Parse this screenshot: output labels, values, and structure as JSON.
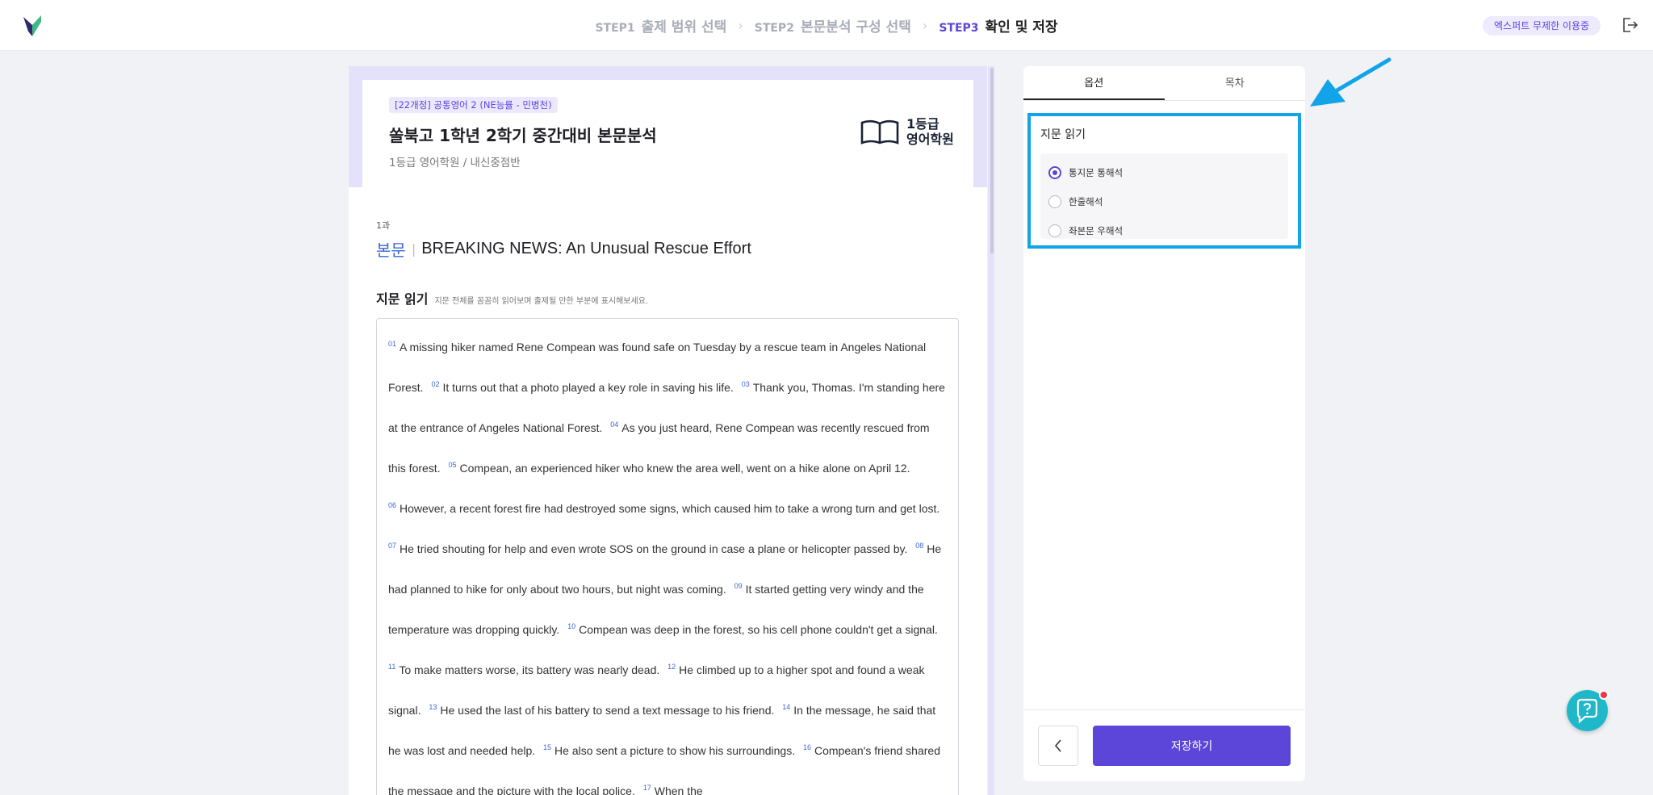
{
  "header": {
    "steps": [
      {
        "num": "STEP1",
        "label": "출제 범위 선택",
        "active": false
      },
      {
        "num": "STEP2",
        "label": "본문분석 구성 선택",
        "active": false
      },
      {
        "num": "STEP3",
        "label": "확인 및 저장",
        "active": true
      }
    ],
    "badge": "엑스퍼트 무제한 이용중",
    "exit_icon": "exit-icon"
  },
  "document": {
    "tag": "[22개정] 공통영어 2 (NE능률 - 민병천)",
    "title": "쏠북고 1학년 2학기 중간대비 본문분석",
    "subtitle": "1등급 영어학원 / 내신중점반",
    "brand": {
      "line1": "1등급",
      "line2": "영어학원"
    },
    "lesson_no": "1과",
    "lesson_kind": "본문",
    "lesson_sep": "|",
    "lesson_title": "BREAKING NEWS: An Unusual Rescue Effort",
    "section_title": "지문 읽기",
    "section_desc": "지문 전체를 꼼꼼히 읽어보며 출제될 만한 부분에 표시해보세요.",
    "sentences": [
      {
        "n": "01",
        "t": "A missing hiker named Rene Compean was found safe on Tuesday by a rescue team in Angeles National Forest."
      },
      {
        "n": "02",
        "t": "It turns out that a photo played a key role in saving his life."
      },
      {
        "n": "03",
        "t": "Thank you, Thomas. I'm standing here at the entrance of Angeles National Forest."
      },
      {
        "n": "04",
        "t": "As you just heard, Rene Compean was recently rescued from this forest."
      },
      {
        "n": "05",
        "t": "Compean, an experienced hiker who knew the area well, went on a hike alone on April 12."
      },
      {
        "n": "06",
        "t": "However, a recent forest fire had destroyed some signs, which caused him to take a wrong turn and get lost."
      },
      {
        "n": "07",
        "t": "He tried shouting for help and even wrote SOS on the ground in case a plane or helicopter passed by."
      },
      {
        "n": "08",
        "t": "He had planned to hike for only about two hours, but night was coming."
      },
      {
        "n": "09",
        "t": "It started getting very windy and the temperature was dropping quickly."
      },
      {
        "n": "10",
        "t": "Compean was deep in the forest, so his cell phone couldn't get a signal."
      },
      {
        "n": "11",
        "t": "To make matters worse, its battery was nearly dead."
      },
      {
        "n": "12",
        "t": "He climbed up to a higher spot and found a weak signal."
      },
      {
        "n": "13",
        "t": "He used the last of his battery to send a text message to his friend."
      },
      {
        "n": "14",
        "t": "In the message, he said that he was lost and needed help."
      },
      {
        "n": "15",
        "t": "He also sent a picture to show his surroundings."
      },
      {
        "n": "16",
        "t": "Compean's friend shared the message and the picture with the local police."
      },
      {
        "n": "17",
        "t": "When the"
      }
    ]
  },
  "side": {
    "tabs": [
      "옵션",
      "목차"
    ],
    "options_title": "지문 읽기",
    "options": [
      {
        "label": "통지문 통해석",
        "selected": true
      },
      {
        "label": "한줄해석",
        "selected": false
      },
      {
        "label": "좌본문 우해석",
        "selected": false
      }
    ],
    "save_label": "저장하기"
  },
  "colors": {
    "accent": "#5b46d9",
    "highlight": "#12a3e8",
    "lesson_kind": "#3b67d6"
  }
}
